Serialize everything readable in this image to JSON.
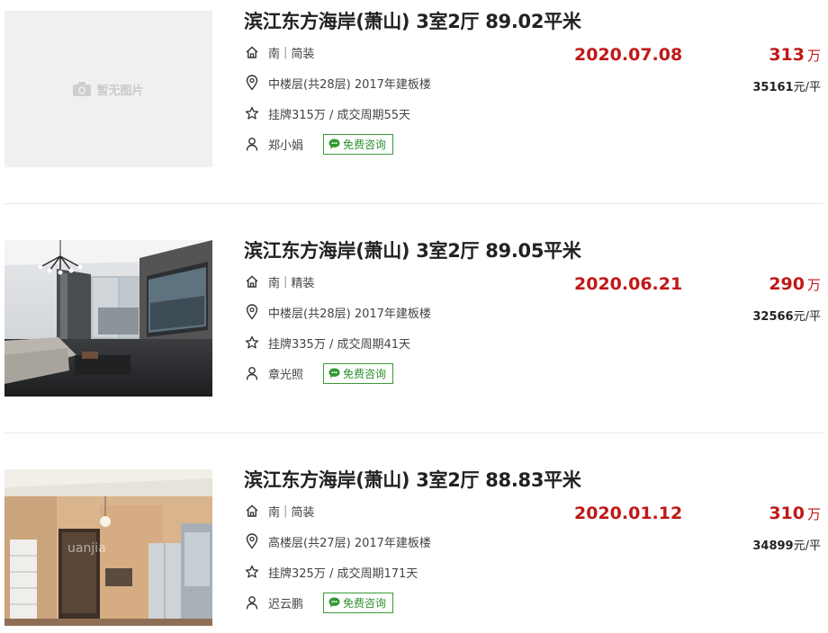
{
  "listings": [
    {
      "title": "滨江东方海岸(萧山) 3室2厅 89.02平米",
      "orientation": "南",
      "decoration": "简装",
      "floor_info": "中楼层(共28层) 2017年建板楼",
      "listing_info": "挂牌315万 / 成交周期55天",
      "agent": "郑小娟",
      "consult_label": "免费咨询",
      "deal_date": "2020.07.08",
      "total_price": "313",
      "price_unit": "万",
      "unit_price": "35161",
      "unit_price_unit": "元/平",
      "image": "placeholder",
      "no_image_text": "暂无图片"
    },
    {
      "title": "滨江东方海岸(萧山) 3室2厅 89.05平米",
      "orientation": "南",
      "decoration": "精装",
      "floor_info": "中楼层(共28层) 2017年建板楼",
      "listing_info": "挂牌335万 / 成交周期41天",
      "agent": "章光照",
      "consult_label": "免费咨询",
      "deal_date": "2020.06.21",
      "total_price": "290",
      "price_unit": "万",
      "unit_price": "32566",
      "unit_price_unit": "元/平",
      "image": "living-room-photo"
    },
    {
      "title": "滨江东方海岸(萧山) 3室2厅 88.83平米",
      "orientation": "南",
      "decoration": "简装",
      "floor_info": "高楼层(共27层) 2017年建板楼",
      "listing_info": "挂牌325万 / 成交周期171天",
      "agent": "迟云鹏",
      "consult_label": "免费咨询",
      "deal_date": "2020.01.12",
      "total_price": "310",
      "price_unit": "万",
      "unit_price": "34899",
      "unit_price_unit": "元/平",
      "image": "dining-room-photo"
    }
  ],
  "colors": {
    "price_red": "#c01818",
    "consult_green": "#2f8f2f"
  }
}
